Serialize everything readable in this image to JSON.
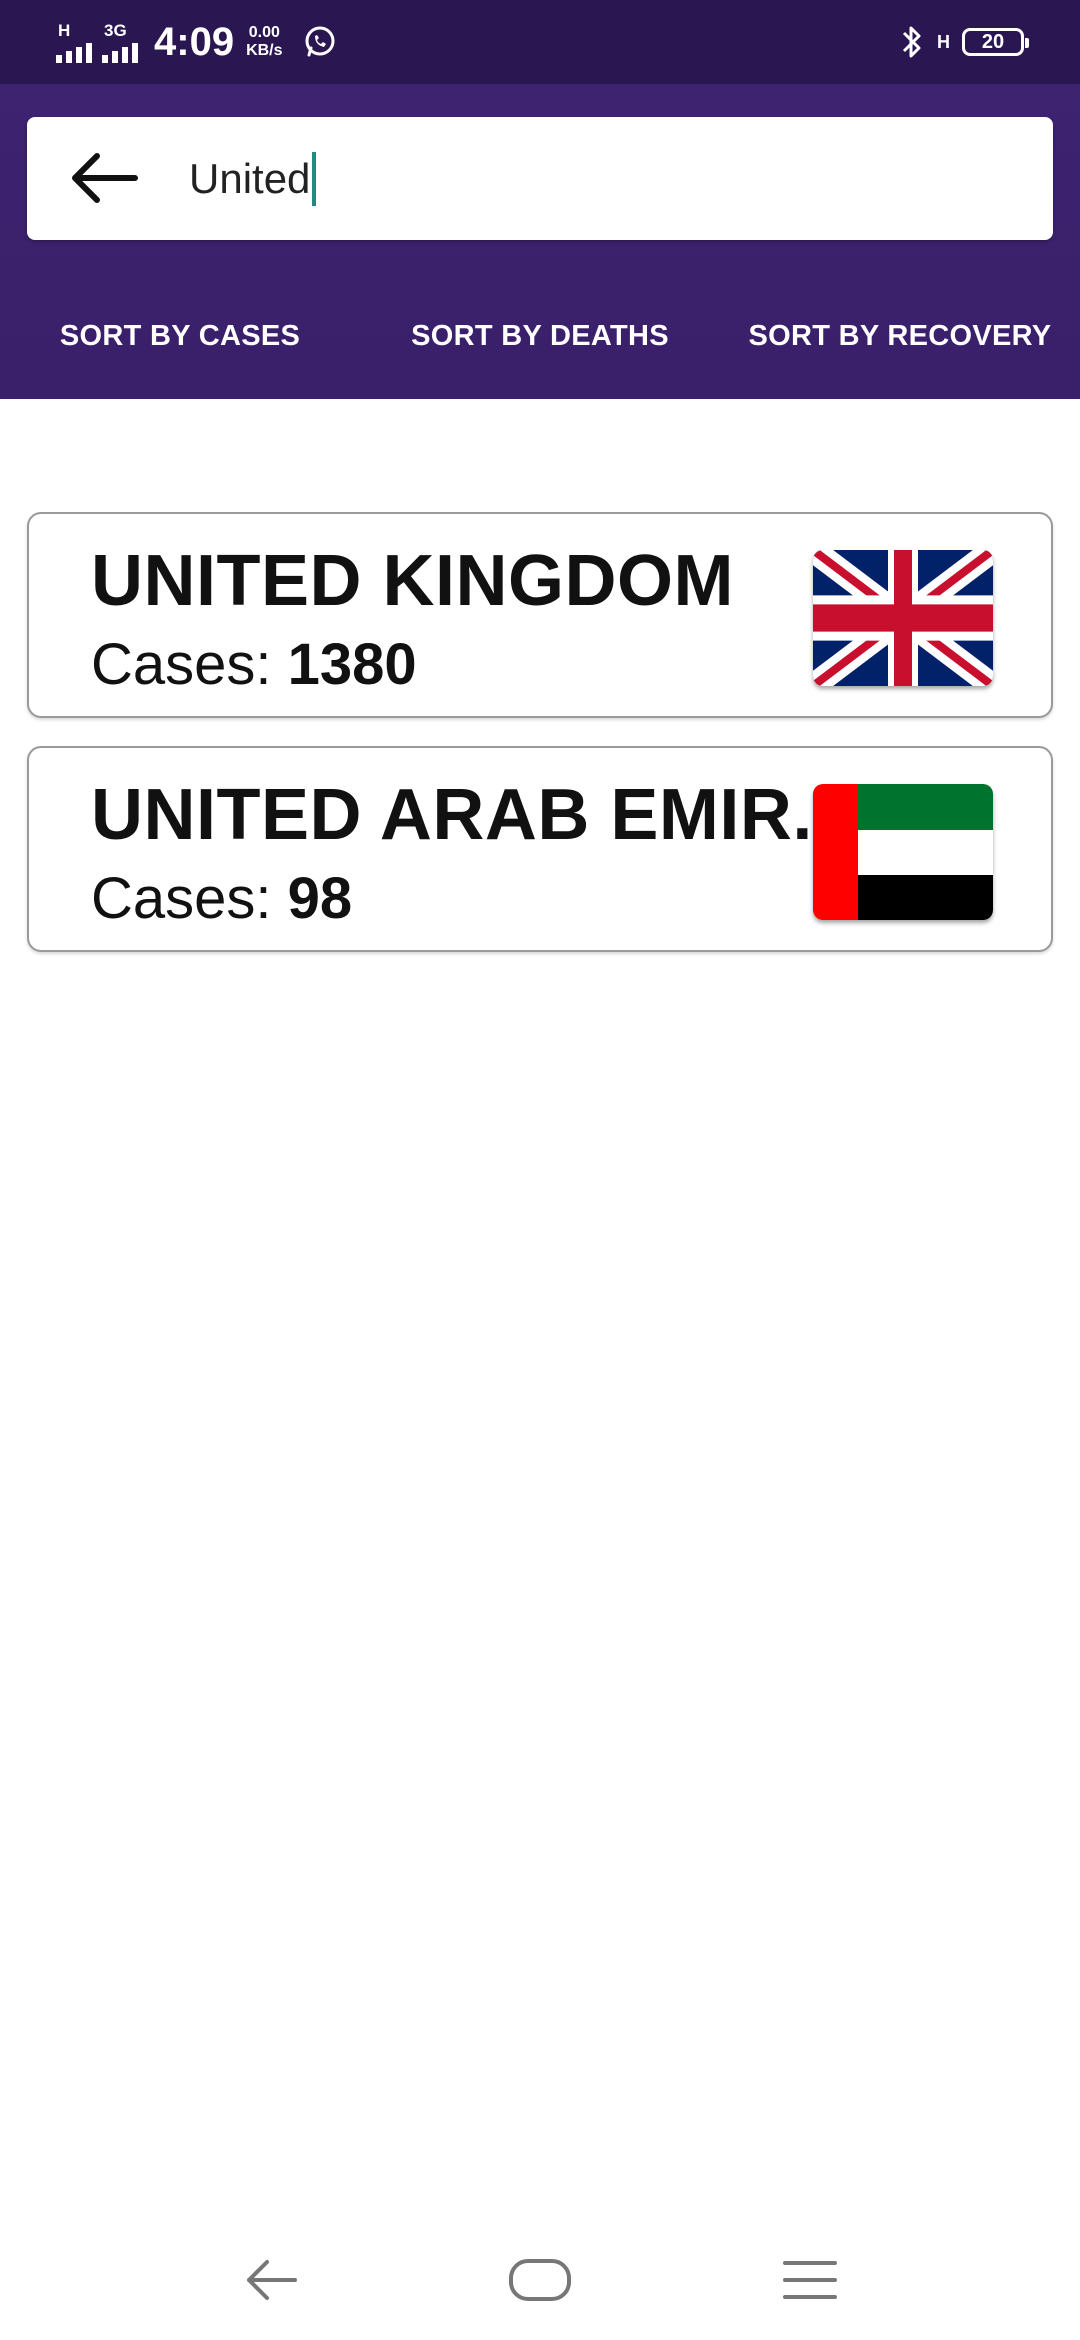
{
  "status_bar": {
    "network1": "H",
    "network2": "3G",
    "time": "4:09",
    "speed_value": "0.00",
    "speed_unit": "KB/s",
    "network_right": "H",
    "battery": "20"
  },
  "search": {
    "value": "United"
  },
  "sort": {
    "cases_label": "SORT BY CASES",
    "deaths_label": "SORT BY DEATHS",
    "recovery_label": "SORT BY RECOVERY"
  },
  "results": [
    {
      "country": "UNITED KINGDOM",
      "cases_label": "Cases:",
      "cases": "1380",
      "flag": "uk-flag"
    },
    {
      "country": "UNITED ARAB EMIR..",
      "cases_label": "Cases:",
      "cases": "98",
      "flag": "uae-flag"
    }
  ],
  "colors": {
    "header": "#3d2370",
    "status_bar": "#2a1650",
    "caret": "#1e8c7e"
  },
  "icons": [
    "back-arrow-icon",
    "whatsapp-icon",
    "bluetooth-icon",
    "nav-back-icon",
    "nav-home-icon",
    "nav-menu-icon"
  ]
}
